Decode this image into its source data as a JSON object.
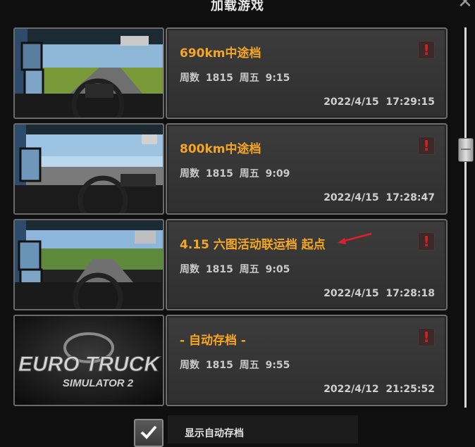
{
  "dialog": {
    "title": "加载游戏"
  },
  "saves": [
    {
      "name": "690km中途档",
      "meta": "周数 1815  周五 9:15",
      "date": "2022/4/15  17:29:15",
      "warning": "!"
    },
    {
      "name": "800km中途档",
      "meta": "周数 1815  周五 9:09",
      "date": "2022/4/15  17:28:47",
      "warning": "!"
    },
    {
      "name": "4.15 六图活动联运档 起点",
      "meta": "周数 1815  周五 9:05",
      "date": "2022/4/15  17:28:18",
      "warning": "!"
    },
    {
      "name": "- 自动存档 -",
      "meta": "周数 1815  周五 9:55",
      "date": "2022/4/12  21:25:52",
      "warning": "!"
    }
  ],
  "thumbnail_logo": {
    "line1": "EURO TRUCK",
    "line2": "SIMULATOR 2"
  },
  "autosave_toggle": {
    "label": "显示自动存档",
    "checked": true
  },
  "colors": {
    "accent": "#f5a623",
    "warning": "#e21b1b",
    "annotation_arrow": "#e0202a"
  }
}
